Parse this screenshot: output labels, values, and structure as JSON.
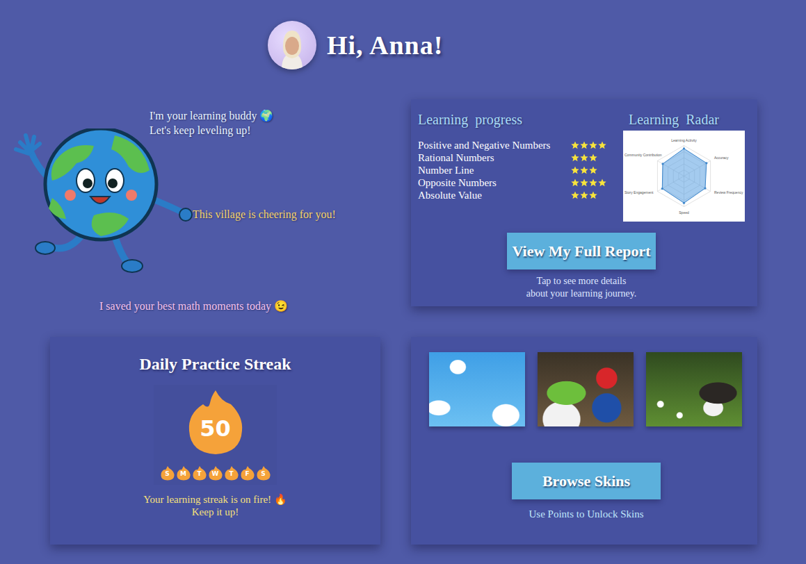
{
  "header": {
    "greeting": "Hi, Anna!"
  },
  "buddy": {
    "lines": [
      "I'm your learning buddy 🌍",
      "Let's keep leveling up!"
    ],
    "cheer": "This village is cheering for you!",
    "moments": "I saved your best math moments today 😉"
  },
  "progress": {
    "title": "Learning  progress",
    "topics": [
      {
        "name": "Positive and Negative Numbers",
        "stars": 4
      },
      {
        "name": "Rational Numbers",
        "stars": 3
      },
      {
        "name": "Number Line",
        "stars": 3
      },
      {
        "name": "Opposite Numbers",
        "stars": 4
      },
      {
        "name": "Absolute Value",
        "stars": 3
      }
    ],
    "radar": {
      "title": "Learning  Radar",
      "axes": [
        "Learning Activity",
        "Accuracy",
        "Review Frequency",
        "Speed",
        "Story Engagement",
        "Community Contribution"
      ],
      "values": [
        90,
        85,
        80,
        88,
        82,
        80
      ]
    },
    "button": "View My Full Report",
    "caption": [
      "Tap to see more details",
      "about your learning journey."
    ]
  },
  "streak": {
    "title": "Daily Practice Streak",
    "count": "50",
    "days": [
      {
        "label": "S",
        "done": true
      },
      {
        "label": "M",
        "done": true
      },
      {
        "label": "T",
        "done": true
      },
      {
        "label": "W",
        "done": true
      },
      {
        "label": "T",
        "done": true
      },
      {
        "label": "F",
        "done": true
      },
      {
        "label": "S",
        "done": true
      }
    ],
    "caption": [
      "Your learning streak is on fire! 🔥",
      "Keep it up!"
    ]
  },
  "skins": {
    "previews": [
      {
        "kind": "sky"
      },
      {
        "kind": "toys"
      },
      {
        "kind": "bunny"
      }
    ],
    "button": "Browse Skins",
    "caption": "Use Points to Unlock Skins"
  }
}
